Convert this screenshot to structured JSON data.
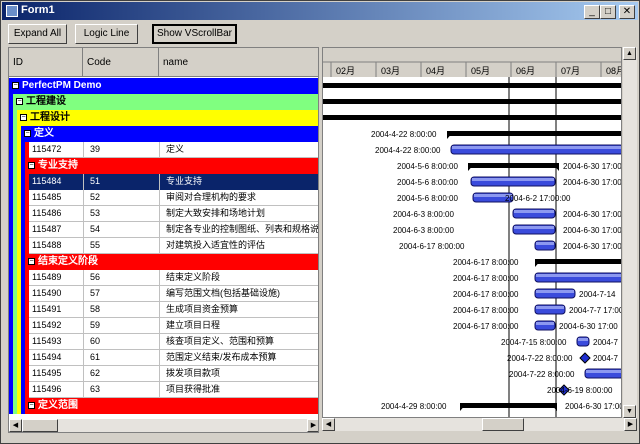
{
  "window": {
    "title": "Form1"
  },
  "toolbar": {
    "expand_all": "Expand All",
    "logic_line": "Logic Line",
    "show_vscrollbar": "Show VScrollBar"
  },
  "grid": {
    "columns": [
      "ID",
      "Code",
      "name"
    ],
    "rows": [
      {
        "kind": "group",
        "level": 0,
        "label": "PerfectPM Demo",
        "color": "#0000ff"
      },
      {
        "kind": "group",
        "level": 1,
        "label": "工程建设",
        "color": "#80ff80",
        "text_color": "#000000"
      },
      {
        "kind": "group",
        "level": 2,
        "label": "工程设计",
        "color": "#ffff00",
        "text_color": "#000000"
      },
      {
        "kind": "group",
        "level": 3,
        "label": "定义",
        "color": "#0000ff"
      },
      {
        "kind": "task",
        "id": "115472",
        "code": "39",
        "name": "定义"
      },
      {
        "kind": "group",
        "level": 4,
        "label": "专业支持",
        "color": "#ff0000"
      },
      {
        "kind": "task",
        "id": "115484",
        "code": "51",
        "name": "专业支持",
        "selected": true
      },
      {
        "kind": "task",
        "id": "115485",
        "code": "52",
        "name": "审阅对合理机构的要求"
      },
      {
        "kind": "task",
        "id": "115486",
        "code": "53",
        "name": "制定大致安排和场地计划"
      },
      {
        "kind": "task",
        "id": "115487",
        "code": "54",
        "name": "制定各专业的控制图纸、列表和规格说明"
      },
      {
        "kind": "task",
        "id": "115488",
        "code": "55",
        "name": "对建筑投入适宜性的评估"
      },
      {
        "kind": "group",
        "level": 4,
        "label": "结束定义阶段",
        "color": "#ff0000"
      },
      {
        "kind": "task",
        "id": "115489",
        "code": "56",
        "name": "结束定义阶段"
      },
      {
        "kind": "task",
        "id": "115490",
        "code": "57",
        "name": "编写范围文档(包括基础设施)"
      },
      {
        "kind": "task",
        "id": "115491",
        "code": "58",
        "name": "生成项目资金预算"
      },
      {
        "kind": "task",
        "id": "115492",
        "code": "59",
        "name": "建立项目日程"
      },
      {
        "kind": "task",
        "id": "115493",
        "code": "60",
        "name": "核查项目定义、范围和预算"
      },
      {
        "kind": "task",
        "id": "115494",
        "code": "61",
        "name": "范围定义结束/发布成本预算"
      },
      {
        "kind": "task",
        "id": "115495",
        "code": "62",
        "name": "拨发项目款项"
      },
      {
        "kind": "task",
        "id": "115496",
        "code": "63",
        "name": "项目获得批准"
      },
      {
        "kind": "group",
        "level": 4,
        "label": "定义范围",
        "color": "#ff0000"
      }
    ]
  },
  "gantt": {
    "months": [
      "02月",
      "03月",
      "04月",
      "05月",
      "06月",
      "07月",
      "08月"
    ],
    "rows": [
      {
        "type": "summary",
        "start_label": "",
        "end_label": ""
      },
      {
        "type": "summary",
        "start_label": "",
        "end_label": ""
      },
      {
        "type": "summary",
        "start_label": "",
        "end_label": ""
      },
      {
        "type": "summary",
        "start_label": "2004-4-22 8:00:00",
        "end_label": ""
      },
      {
        "type": "task",
        "start_label": "2004-4-22 8:00:00",
        "end_label": ""
      },
      {
        "type": "summary",
        "start_label": "2004-5-6 8:00:00",
        "end_label": "2004-6-30 17:00:00"
      },
      {
        "type": "task",
        "start_label": "2004-5-6 8:00:00",
        "end_label": "2004-6-30 17:00:00"
      },
      {
        "type": "task",
        "start_label": "2004-5-6 8:00:00",
        "end_label": "2004-6-2 17:00:00"
      },
      {
        "type": "task",
        "start_label": "2004-6-3 8:00:00",
        "end_label": "2004-6-30 17:00:00"
      },
      {
        "type": "task",
        "start_label": "2004-6-3 8:00:00",
        "end_label": "2004-6-30 17:00:00"
      },
      {
        "type": "task",
        "start_label": "2004-6-17 8:00:00",
        "end_label": "2004-6-30 17:00:00"
      },
      {
        "type": "summary",
        "start_label": "2004-6-17 8:00:00",
        "end_label": ""
      },
      {
        "type": "task",
        "start_label": "2004-6-17 8:00:00",
        "end_label": ""
      },
      {
        "type": "task",
        "start_label": "2004-6-17 8:00:00",
        "end_label": "2004-7-14"
      },
      {
        "type": "task",
        "start_label": "2004-6-17 8:00:00",
        "end_label": "2004-7-7 17:00"
      },
      {
        "type": "task",
        "start_label": "2004-6-17 8:00:00",
        "end_label": "2004-6-30 17:00"
      },
      {
        "type": "task",
        "start_label": "2004-7-15 8:00:00",
        "end_label": "2004-7"
      },
      {
        "type": "milestone",
        "start_label": "2004-7-22 8:00:00",
        "end_label": "2004-7"
      },
      {
        "type": "task",
        "start_label": "2004-7-22 8:00:00",
        "end_label": ""
      },
      {
        "type": "milestone",
        "start_label": "2004-6-19 8:00:00",
        "end_label": ""
      },
      {
        "type": "summary",
        "start_label": "2004-4-29 8:00:00",
        "end_label": "2004-6-30 17:00"
      }
    ]
  }
}
